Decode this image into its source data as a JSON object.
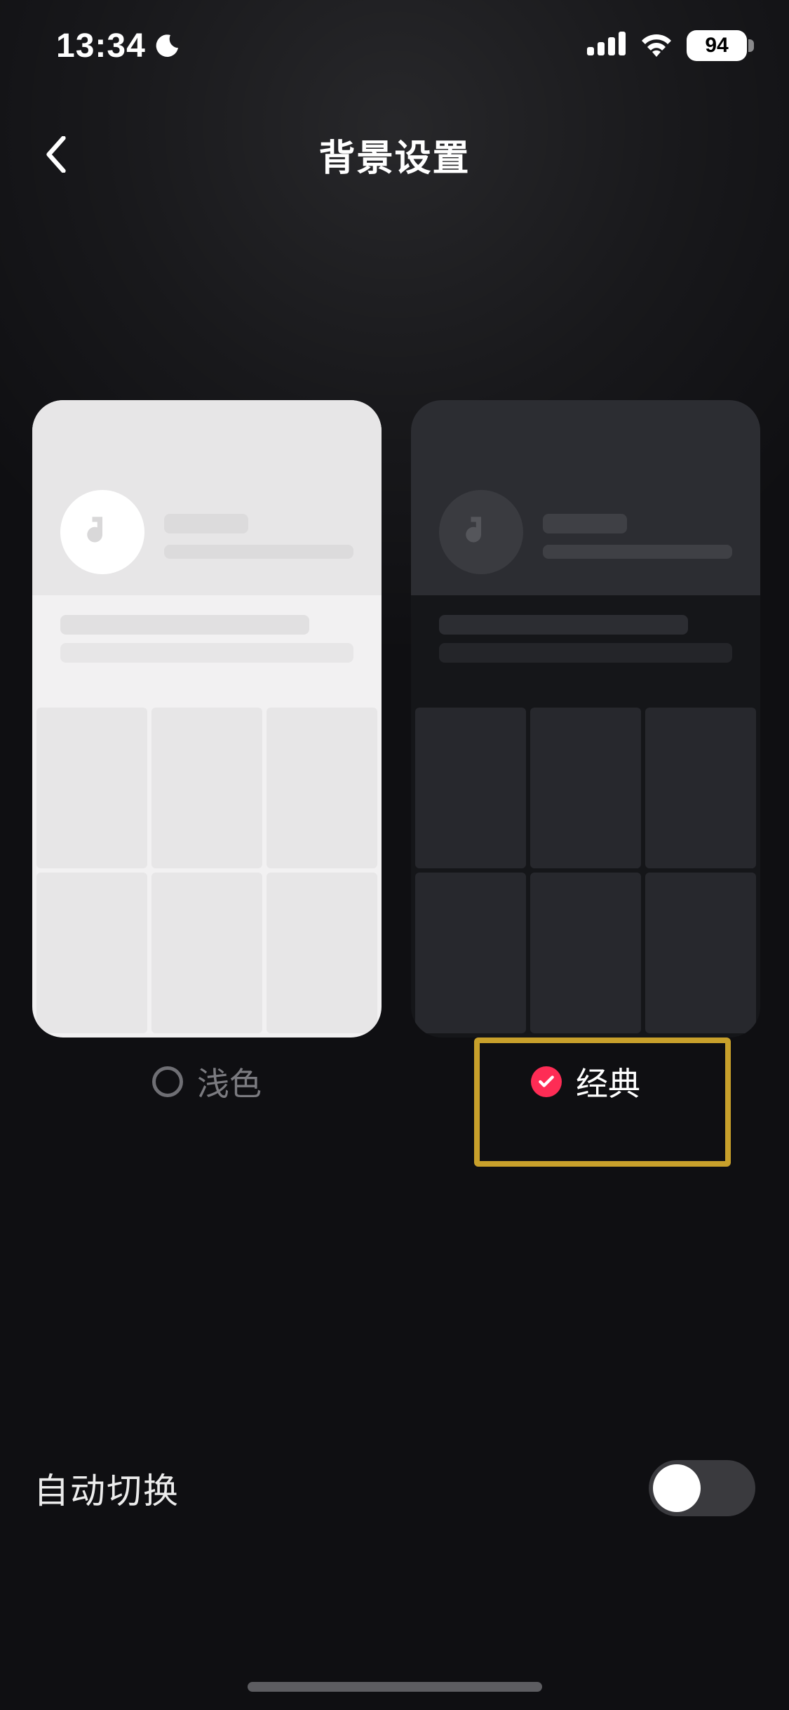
{
  "status_bar": {
    "time": "13:34",
    "battery_percent": "94"
  },
  "nav": {
    "title": "背景设置"
  },
  "themes": {
    "light": {
      "label": "浅色",
      "selected": false
    },
    "classic": {
      "label": "经典",
      "selected": true
    }
  },
  "auto_switch": {
    "label": "自动切换",
    "enabled": false
  },
  "colors": {
    "accent": "#fe2c55",
    "highlight_box": "#c8a02b",
    "background": "#0f0f12"
  }
}
